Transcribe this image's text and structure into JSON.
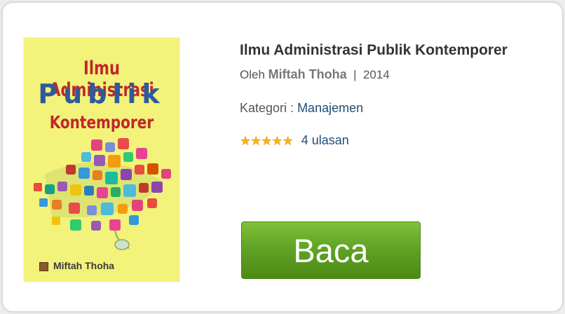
{
  "book": {
    "title": "Ilmu Administrasi Publik Kontemporer",
    "by_label": "Oleh",
    "author": "Miftah Thoha",
    "separator": "|",
    "year": "2014",
    "category_label": "Kategori :",
    "category": "Manajemen",
    "rating": 5,
    "rating_max": 5,
    "reviews": "4 ulasan",
    "read_button": "Baca"
  },
  "cover": {
    "line1": "Ilmu Administrasi",
    "line2": "Publik",
    "line3": "Kontemporer",
    "author": "Miftah Thoha"
  },
  "colors": {
    "button": "#5fa123",
    "link": "#1f4e79",
    "star": "#f7b21a",
    "cover_bg": "#f3f27a"
  }
}
